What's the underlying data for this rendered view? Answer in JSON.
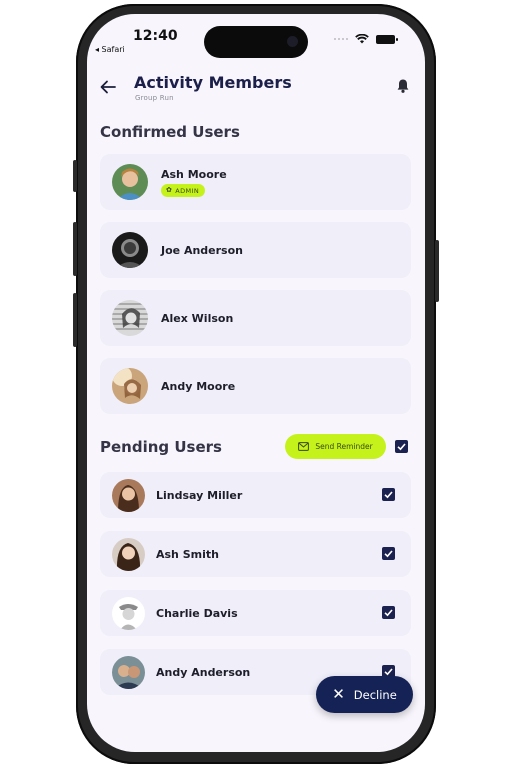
{
  "status_bar": {
    "time": "12:40",
    "back_app": "◂ Safari"
  },
  "header": {
    "title": "Activity Members",
    "subtitle": "Group Run"
  },
  "confirmed": {
    "title": "Confirmed Users",
    "users": [
      {
        "name": "Ash Moore",
        "badge": "ADMIN"
      },
      {
        "name": "Joe Anderson"
      },
      {
        "name": "Alex Wilson"
      },
      {
        "name": "Andy Moore"
      }
    ]
  },
  "pending": {
    "title": "Pending Users",
    "send_reminder_label": "Send Reminder",
    "select_all_checked": true,
    "users": [
      {
        "name": "Lindsay Miller",
        "checked": true
      },
      {
        "name": "Ash Smith",
        "checked": true
      },
      {
        "name": "Charlie Davis",
        "checked": true
      },
      {
        "name": "Andy Anderson",
        "checked": true
      }
    ]
  },
  "decline_label": "Decline",
  "colors": {
    "navy": "#1b2250",
    "lime": "#c5f21b",
    "card": "#efeef9",
    "background": "#f8f6fc"
  }
}
